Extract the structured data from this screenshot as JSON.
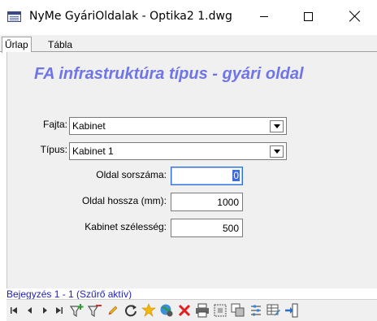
{
  "window": {
    "title": "NyMe GyáriOldalak - Optika2 1.dwg"
  },
  "tabs": [
    {
      "label": "Űrlap"
    },
    {
      "label": "Tábla"
    }
  ],
  "form": {
    "title": "FA infrastruktúra típus - gyári oldal",
    "fajta": {
      "label": "Fajta:",
      "value": "Kabinet"
    },
    "tipus": {
      "label": "Típus:",
      "value": "Kabinet 1"
    },
    "oldal_sorszama": {
      "label": "Oldal sorszáma:",
      "value": "0"
    },
    "oldal_hossza": {
      "label": "Oldal hossza (mm):",
      "value": "1000"
    },
    "kabinet_szelesseg": {
      "label": "Kabinet szélesség:",
      "value": "500"
    }
  },
  "status": {
    "text": "Bejegyzés 1 - 1 (Szűrő aktív)"
  },
  "navbar": {
    "icons": [
      "first-record-icon",
      "previous-record-icon",
      "next-record-icon",
      "last-record-icon",
      "filter-add-icon",
      "filter-remove-icon",
      "edit-pencil-icon",
      "refresh-icon",
      "new-record-icon",
      "web-link-icon",
      "delete-icon",
      "print-icon",
      "select-frame-icon",
      "copy-icon",
      "settings-icon",
      "table-edit-icon",
      "exit-icon"
    ]
  },
  "colors": {
    "title_accent": "#6f74e8",
    "status_text": "#1f1fb8",
    "focus_highlight": "#3d6be0"
  }
}
